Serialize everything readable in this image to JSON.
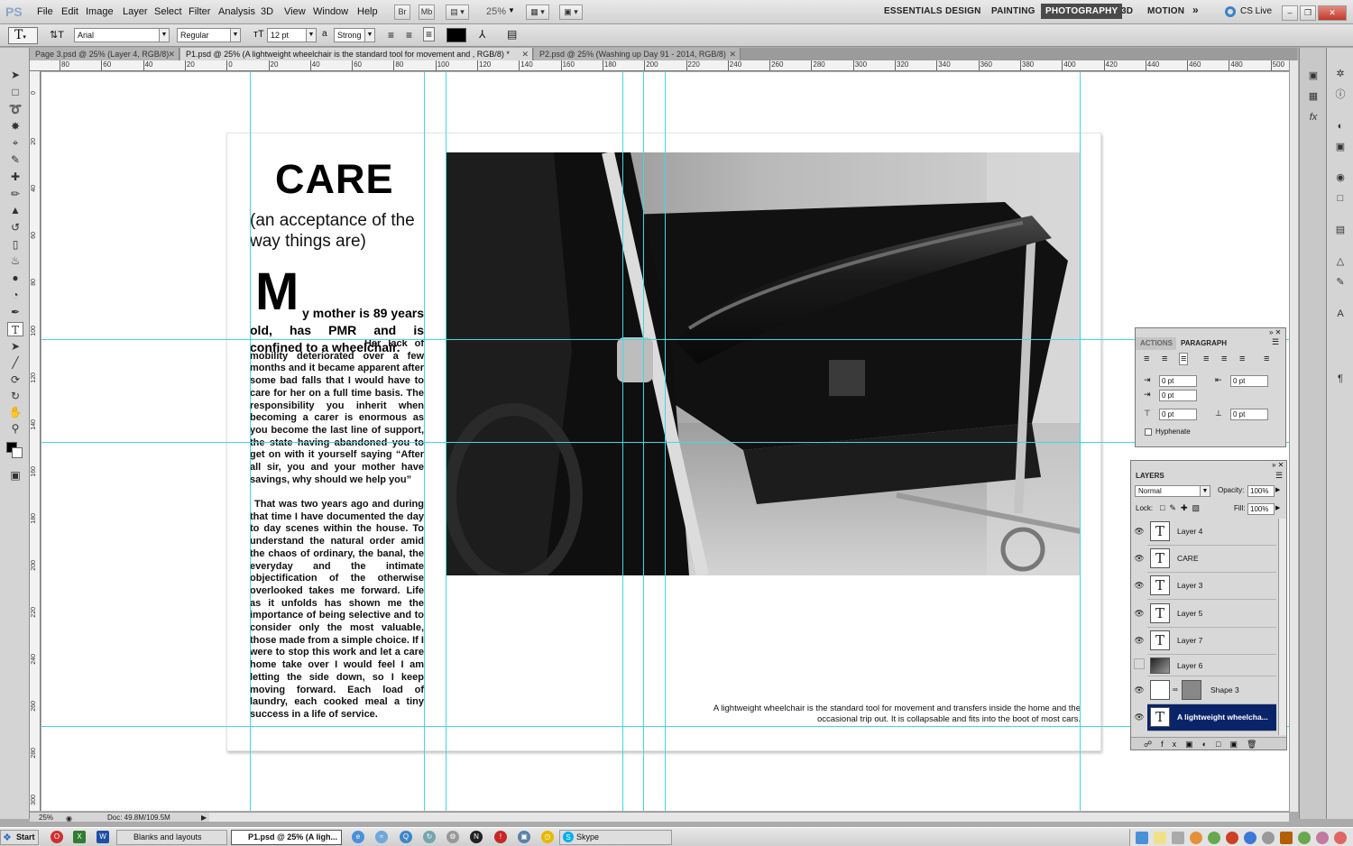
{
  "app": {
    "logo": "PS"
  },
  "menubar": {
    "items": [
      "File",
      "Edit",
      "Image",
      "Layer",
      "Select",
      "Filter",
      "Analysis",
      "3D",
      "View",
      "Window",
      "Help"
    ],
    "zoom": "25%",
    "buttons": {
      "bridge": "Br",
      "mini": "Mb"
    },
    "workspaces": [
      "ESSENTIALS",
      "DESIGN",
      "PAINTING",
      "PHOTOGRAPHY",
      "3D",
      "MOTION"
    ],
    "active_workspace": "PHOTOGRAPHY",
    "cs_live": "CS Live"
  },
  "options": {
    "font_family": "Arial",
    "font_style": "Regular",
    "font_size": "12 pt",
    "aa_label": "a",
    "antialias": "Strong",
    "text_color": "#000000"
  },
  "tabs": [
    {
      "label": "Page 3.psd @ 25% (Layer 4, RGB/8)",
      "active": false
    },
    {
      "label": "P1.psd @ 25% (A lightweight wheelchair is the standard tool for movement and , RGB/8) *",
      "active": true
    },
    {
      "label": "P2.psd @ 25% (Washing up Day 91 - 2014, RGB/8)",
      "active": false
    }
  ],
  "ruler": {
    "top": [
      "80",
      "60",
      "40",
      "20",
      "0",
      "20",
      "40",
      "60",
      "80",
      "100",
      "120",
      "140",
      "160",
      "180",
      "200",
      "220",
      "240",
      "260",
      "280",
      "300",
      "320",
      "340",
      "360",
      "380",
      "400",
      "420",
      "440",
      "460",
      "480",
      "500"
    ],
    "left": [
      "0",
      "20",
      "40",
      "60",
      "80",
      "100",
      "120",
      "140",
      "160",
      "180",
      "200",
      "220",
      "240",
      "260",
      "280",
      "300"
    ]
  },
  "document": {
    "title": "CARE",
    "subtitle": "(an acceptance of the way things are)",
    "drop_cap": "M",
    "lead": "y mother is 89 years old, has PMR and is confined to a wheelchair.",
    "para1": "Her lack of mobility deteriorated over a few months and it became apparent after some bad falls that I would have to care for her on a full time basis. The responsibility you inherit when becoming a carer is enormous as you become the last line of support, the state having abandoned you to get on with it yourself saying “After all sir, you and your mother have savings, why should we help you”",
    "para2": "That was two years ago and during that time I have documented the day to day scenes within the house. To understand the natural order amid the chaos of ordinary, the banal, the everyday and the intimate objectification of the otherwise overlooked takes me forward. Life as it unfolds has shown me the importance of being selective and to consider only the most valuable, those made from a simple choice. If I were to stop this work and let a care home take over I would feel I am letting the side down, so I keep moving forward. Each load of laundry, each cooked meal a tiny success in a life of service.",
    "caption": "A lightweight wheelchair is the standard tool for movement and transfers inside the home and the occasional trip out. It is collapsable and fits into the boot of most cars."
  },
  "status": {
    "zoom": "25%",
    "doc": "Doc: 49.8M/109.5M"
  },
  "paragraph_panel": {
    "tabs": [
      "ACTIONS",
      "PARAGRAPH"
    ],
    "active_tab": "PARAGRAPH",
    "indent_left": "0 pt",
    "indent_right": "0 pt",
    "indent_first": "0 pt",
    "space_before": "0 pt",
    "space_after": "0 pt",
    "hyphenate": "Hyphenate"
  },
  "layers_panel": {
    "title": "LAYERS",
    "blend_mode": "Normal",
    "opacity_label": "Opacity:",
    "opacity": "100%",
    "lock_label": "Lock:",
    "fill_label": "Fill:",
    "fill": "100%",
    "layers": [
      {
        "name": "Layer 4",
        "type": "text",
        "visible": true,
        "selected": false
      },
      {
        "name": "CARE",
        "type": "text",
        "visible": true,
        "selected": false
      },
      {
        "name": "Layer 3",
        "type": "text",
        "visible": true,
        "selected": false
      },
      {
        "name": "Layer 5",
        "type": "text",
        "visible": true,
        "selected": false
      },
      {
        "name": "Layer 7",
        "type": "text",
        "visible": true,
        "selected": false
      },
      {
        "name": "Layer 6",
        "type": "image",
        "visible": false,
        "selected": false
      },
      {
        "name": "Shape 3",
        "type": "shape",
        "visible": true,
        "selected": false
      },
      {
        "name": "A lightweight wheelcha...",
        "type": "text",
        "visible": true,
        "selected": true
      }
    ]
  },
  "taskbar": {
    "start": "Start",
    "windows": [
      {
        "label": "Blanks and layouts",
        "active": false
      },
      {
        "label": "P1.psd @ 25% (A ligh...",
        "active": true
      },
      {
        "label": "Skype",
        "active": false
      }
    ]
  },
  "colors": {
    "guide": "#3fd8e6",
    "selected_layer": "#0a246a",
    "workspace_active": "#4a4a4a"
  }
}
